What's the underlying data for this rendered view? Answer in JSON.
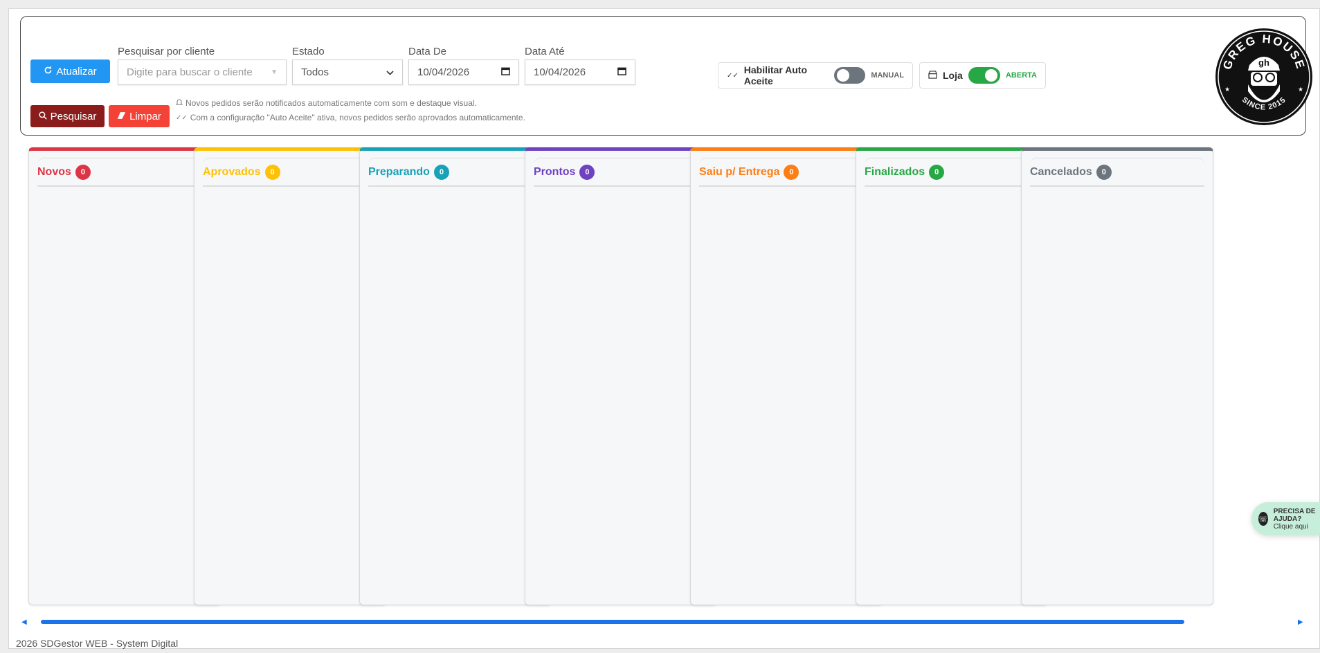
{
  "toolbar": {
    "refresh_label": "Atualizar",
    "search_label": "Pesquisar",
    "clear_label": "Limpar"
  },
  "filters": {
    "client_label": "Pesquisar por cliente",
    "client_placeholder": "Digite para buscar o cliente",
    "status_label": "Estado",
    "status_value": "Todos",
    "date_from_label": "Data De",
    "date_from_value": "10/04/2026",
    "date_to_label": "Data Até",
    "date_to_value": "10/04/2026"
  },
  "hints": {
    "notify": "Novos pedidos serão notificados automaticamente com som e destaque visual.",
    "auto_accept": "Com a configuração \"Auto Aceite\" ativa, novos pedidos serão aprovados automaticamente."
  },
  "auto_accept": {
    "label": "Habilitar Auto Aceite",
    "state": "MANUAL",
    "enabled": false
  },
  "store": {
    "label": "Loja",
    "state": "ABERTA",
    "open": true
  },
  "logo": {
    "top_text": "GREG HOUSE",
    "bottom_text": "SINCE 2015",
    "monogram": "gh"
  },
  "columns": [
    {
      "title": "Novos",
      "count": "0",
      "color": "#dc3545"
    },
    {
      "title": "Aprovados",
      "count": "0",
      "color": "#ffc107"
    },
    {
      "title": "Preparando",
      "count": "0",
      "color": "#17a2b8"
    },
    {
      "title": "Prontos",
      "count": "0",
      "color": "#6f42c1"
    },
    {
      "title": "Saiu p/ Entrega",
      "count": "0",
      "color": "#fd7e14"
    },
    {
      "title": "Finalizados",
      "count": "0",
      "color": "#28a745"
    },
    {
      "title": "Cancelados",
      "count": "0",
      "color": "#6c757d"
    }
  ],
  "footer": {
    "text": "2026 SDGestor WEB - System Digital"
  },
  "help": {
    "line1": "PRECISA DE AJUDA?",
    "line2": "Clique aqui"
  }
}
